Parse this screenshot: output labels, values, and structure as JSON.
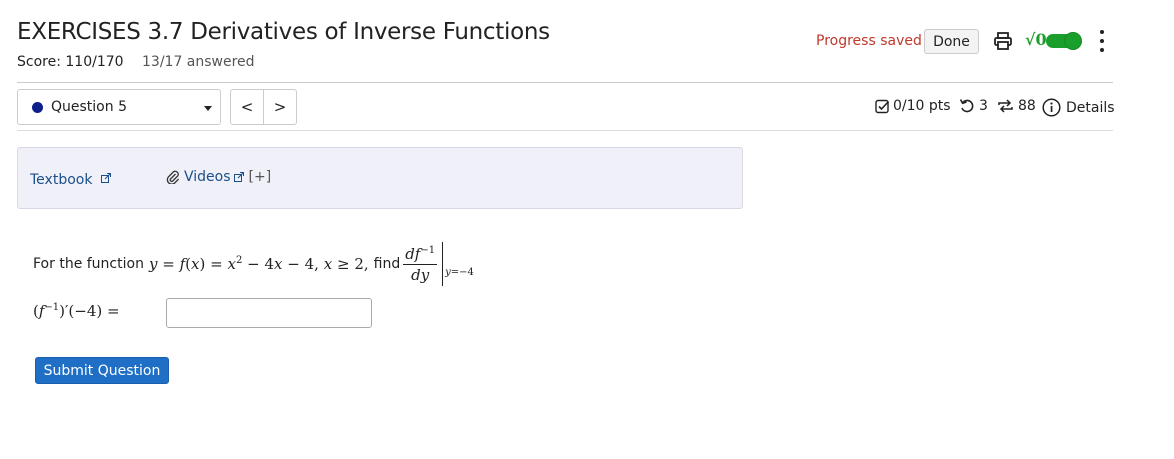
{
  "header": {
    "title": "EXERCISES 3.7 Derivatives of Inverse Functions",
    "score": "Score: 110/170",
    "answered": "13/17 answered",
    "progress_saved": "Progress saved",
    "done_label": "Done",
    "sqrt_label": "√0"
  },
  "question_nav": {
    "selected": "Question 5",
    "prev": "<",
    "next": ">"
  },
  "meta": {
    "points": "0/10 pts",
    "attempts": "3",
    "versions": "88",
    "details": "Details"
  },
  "help": {
    "textbook": "Textbook",
    "videos": "Videos",
    "expand": "[+]"
  },
  "question": {
    "prefix": "For the function",
    "find": "find",
    "answer_value": "",
    "submit_label": "Submit Question"
  },
  "colors": {
    "accent_blue": "#1f6fc7",
    "status_red": "#c0392b",
    "toggle_green": "#1a9e2c",
    "question_dot": "#0c1f8a"
  }
}
